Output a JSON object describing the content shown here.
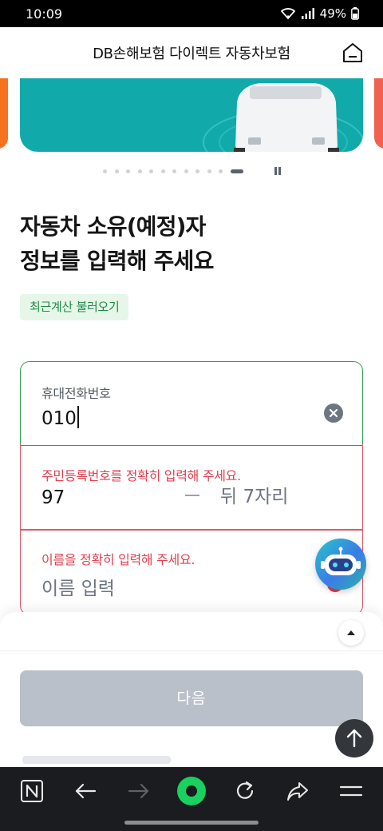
{
  "status_bar": {
    "time": "10:09",
    "battery": "49%",
    "icons": [
      "wifi-icon",
      "signal-icon",
      "battery-icon"
    ]
  },
  "header": {
    "title": "DB손해보험 다이렉트 자동차보험",
    "home_icon": "home-icon"
  },
  "carousel": {
    "dot_count": 12,
    "active_index": 11,
    "pause_icon": "pause-icon"
  },
  "main": {
    "headline_line1": "자동차 소유(예정)자",
    "headline_line2": "정보를 입력해 주세요",
    "recall_button": "최근계산 불러오기"
  },
  "form": {
    "phone": {
      "label": "휴대전화번호",
      "value": "010",
      "clear_icon": "clear-icon"
    },
    "ssn": {
      "error": "주민등록번호를 정확히 입력해 주세요.",
      "front_value": "97",
      "back_placeholder": "뒤 7자리"
    },
    "name": {
      "error": "이름을 정확히 입력해 주세요.",
      "placeholder": "이름 입력"
    }
  },
  "bottom_sheet": {
    "next_button": "다음",
    "toggle_icon": "chevron-up-icon"
  },
  "colors": {
    "accent_green": "#2d9f55",
    "error_red": "#e0404f",
    "banner_teal": "#12a9aa",
    "button_disabled": "#b9c0c9"
  }
}
